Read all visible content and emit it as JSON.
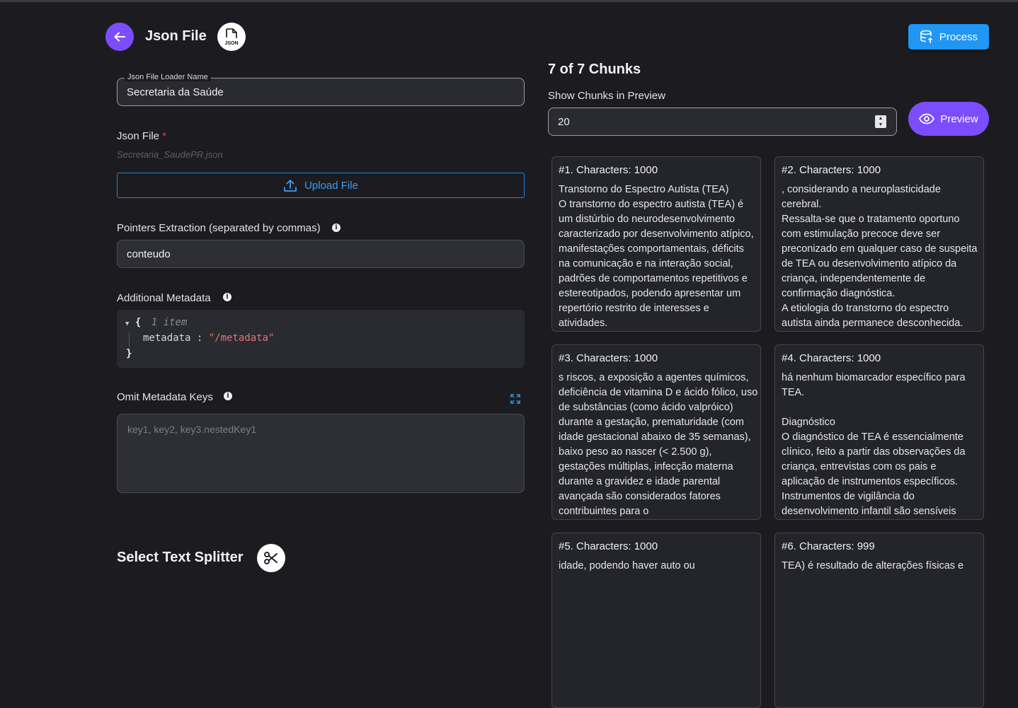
{
  "header": {
    "title": "Json File",
    "badge_text": "JSON",
    "process_label": "Process"
  },
  "form": {
    "loader_name": {
      "legend": "Json File Loader Name",
      "value": "Secretaria da Saúde"
    },
    "json_file": {
      "label": "Json File",
      "required_mark": "*",
      "filename": "Secretaria_SaudePR.json",
      "upload_label": "Upload File"
    },
    "pointers": {
      "label": "Pointers Extraction (separated by commas)",
      "value": "conteudo"
    },
    "metadata": {
      "label": "Additional Metadata",
      "open_brace": "{",
      "item_count": "1 item",
      "key": "metadata",
      "colon": ":",
      "value": "\"/metadata\"",
      "close_brace": "}"
    },
    "omit_keys": {
      "label": "Omit Metadata Keys",
      "placeholder": "key1, key2, key3.nestedKey1"
    },
    "splitter_title": "Select Text Splitter"
  },
  "preview": {
    "title": "7 of 7 Chunks",
    "show_label": "Show Chunks in Preview",
    "show_value": "20",
    "preview_label": "Preview",
    "chunks": [
      {
        "title": "#1. Characters: 1000",
        "text": "Transtorno do Espectro Autista (TEA)\nO transtorno do espectro autista (TEA) é um distúrbio do neurodesenvolvimento caracterizado por desenvolvimento atípico, manifestações comportamentais, déficits na comunicação e na interação social, padrões de comportamentos repetitivos e estereotipados, podendo apresentar um repertório restrito de interesses e atividades."
      },
      {
        "title": "#2. Characters: 1000",
        "text": ", considerando a neuroplasticidade cerebral.\nRessalta-se que o tratamento oportuno com estimulação precoce deve ser preconizado em qualquer caso de suspeita de TEA ou desenvolvimento atípico da criança, independentemente de confirmação diagnóstica.\nA etiologia do transtorno do espectro autista ainda permanece desconhecida."
      },
      {
        "title": "#3. Characters: 1000",
        "text": "s riscos, a exposição a agentes químicos, deficiência de vitamina D e ácido fólico, uso de substâncias (como ácido valpróico) durante a gestação, prematuridade (com idade gestacional abaixo de 35 semanas), baixo peso ao nascer (< 2.500 g), gestações múltiplas, infecção materna durante a gravidez e idade parental avançada são considerados fatores contribuintes para o"
      },
      {
        "title": "#4. Characters: 1000",
        "text": "há nenhum biomarcador específico para TEA.\n\nDiagnóstico\nO diagnóstico de TEA é essencialmente clínico, feito a partir das observações da criança, entrevistas com os pais e aplicação de instrumentos específicos. Instrumentos de vigilância do desenvolvimento infantil são sensíveis"
      },
      {
        "title": "#5. Characters: 1000",
        "text": "idade, podendo haver auto ou"
      },
      {
        "title": "#6. Characters: 999",
        "text": "TEA) é resultado de alterações físicas e"
      }
    ]
  }
}
